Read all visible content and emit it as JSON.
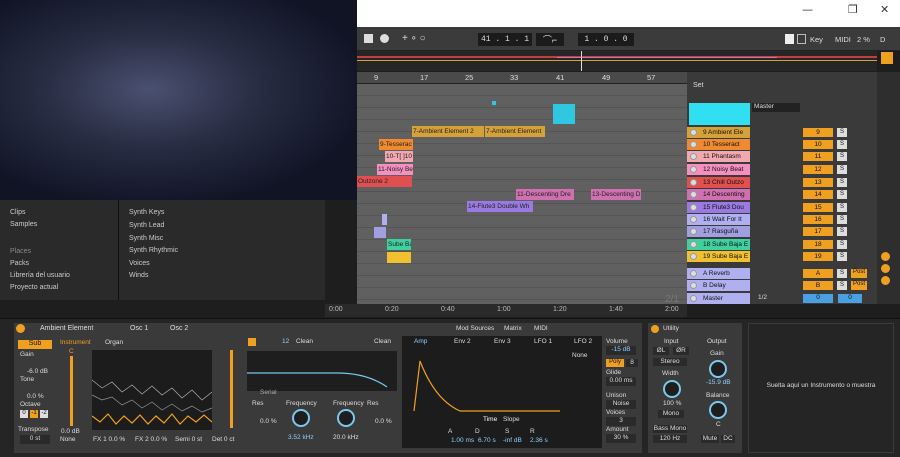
{
  "window": {
    "min": "—",
    "max": "❐",
    "close": "✕"
  },
  "toolbar": {
    "position": "41 .  1 .  1",
    "loop_length": "1 .  0 .  0",
    "key": "Key",
    "midi": "MIDI",
    "cpu": "2 %",
    "d": "D"
  },
  "ruler": {
    "marks": [
      "9",
      "17",
      "25",
      "33",
      "41",
      "49",
      "57"
    ]
  },
  "set_label": "Set",
  "master_select": "Master",
  "clips": [
    {
      "label": "7-Ambient Element 2",
      "color": "#d5a23a"
    },
    {
      "label": "7-Ambient Element",
      "color": "#d5a23a"
    },
    {
      "label": "9-Tesserac",
      "color": "#f08a30"
    },
    {
      "label": "10-T[ ]10",
      "color": "#f2a8b0"
    },
    {
      "label": "11-Noisy Be",
      "color": "#f48fc0"
    },
    {
      "label": "Outzone 2",
      "color": "#e05050"
    },
    {
      "label": "11-Descenting Dre",
      "color": "#d070b0"
    },
    {
      "label": "13-Descenting D",
      "color": "#d070b0"
    },
    {
      "label": "14-Flute3 Double Wh",
      "color": "#9a7ae0"
    },
    {
      "label": "Sube Ba",
      "color": "#40d0a0"
    }
  ],
  "tracks": [
    {
      "name": "9 Ambient Ele",
      "num": "9",
      "color": "#d5a23a"
    },
    {
      "name": "10 Tesseract",
      "num": "10",
      "color": "#f08a30"
    },
    {
      "name": "11 Phantasm",
      "num": "11",
      "color": "#f2a8b0"
    },
    {
      "name": "12 Noisy Beat",
      "num": "12",
      "color": "#f48fc0"
    },
    {
      "name": "13 Chill Outzo",
      "num": "13",
      "color": "#e05050"
    },
    {
      "name": "14 Descenting",
      "num": "14",
      "color": "#d070b0"
    },
    {
      "name": "15 Flute3 Dou",
      "num": "15",
      "color": "#9a7ae0"
    },
    {
      "name": "16 Wait For It",
      "num": "16",
      "color": "#b0b0f0"
    },
    {
      "name": "17 Rasguña",
      "num": "17",
      "color": "#a0a0e0"
    },
    {
      "name": "18 Sube Baja E",
      "num": "18",
      "color": "#40d0a0"
    },
    {
      "name": "19 Sube Baja E",
      "num": "19",
      "color": "#f0c030"
    }
  ],
  "returns": [
    {
      "name": "A Reverb",
      "num": "A",
      "post": "Post"
    },
    {
      "name": "B Delay",
      "num": "B",
      "post": "Post"
    }
  ],
  "master": {
    "name": "Master",
    "ratio": "1/2",
    "val": "0"
  },
  "solo": "S",
  "browser": {
    "left": [
      "Clips",
      "Samples",
      "Places",
      "Packs",
      "Librería del usuario",
      "Proyecto actual"
    ],
    "right": [
      "Synth Keys",
      "Synth Lead",
      "Synth Misc",
      "Synth Rhythmic",
      "Voices",
      "Winds"
    ]
  },
  "timeline": {
    "marks": [
      "0:00",
      "0:20",
      "0:40",
      "1:00",
      "1:20",
      "1:40",
      "2:00"
    ],
    "ratio": "2/1"
  },
  "device": {
    "title": "Ambient Element",
    "osc1": "Osc 1",
    "osc2": "Osc 2",
    "sub": "Sub",
    "gain": "Gain",
    "gain_val": "-6.0 dB",
    "tone": "Tone",
    "tone_val": "0.0 %",
    "octave": "Octave",
    "oct_vals": [
      "0",
      "-1",
      "-2"
    ],
    "transpose": "Transpose",
    "transpose_val": "0 st",
    "instrument": "Instrument",
    "organ": "Organ",
    "c_label": "C",
    "db_val": "0.0 dB",
    "none": "None",
    "fx1": "FX 1  0.0 %",
    "fx2": "FX 2  0.0 %",
    "semi": "Semi  0 st",
    "det": "Det  0 ct",
    "filter_num": "12",
    "clean": "Clean",
    "clean2": "Clean",
    "serial": "Serial",
    "res": "Res",
    "res_val": "0.0 %",
    "frequency": "Frequency",
    "freq_val": "3.52 kHz",
    "frequency2": "Frequency",
    "freq2_val": "20.0 kHz",
    "res2": "Res",
    "res2_val": "0.0 %",
    "tabs": [
      "Mod Sources",
      "Matrix",
      "MIDI"
    ],
    "env_tabs": [
      "Amp",
      "Env 2",
      "Env 3",
      "LFO 1",
      "LFO 2"
    ],
    "env_none": "None",
    "time": "Time",
    "slope": "Slope",
    "adsr": [
      "A",
      "D",
      "S",
      "R"
    ],
    "adsr_vals": [
      "1.00 ms",
      "6.70 s",
      "-inf dB",
      "2.36 s"
    ],
    "volume": "Volume",
    "volume_val": "-15 dB",
    "poly": "Poly",
    "poly_val": "8",
    "glide": "Glide",
    "glide_val": "0.00 ms",
    "unison": "Unison",
    "unison_val": "Noise",
    "voices": "Voices",
    "voices_val": "3",
    "amount": "Amount",
    "amount_val": "30 %"
  },
  "utility": {
    "title": "Utility",
    "input": "Input",
    "output": "Output",
    "lphase": "ØL",
    "rphase": "ØR",
    "stereo": "Stereo",
    "gain": "Gain",
    "gain_val": "-15.9 dB",
    "width": "Width",
    "width_val": "100 %",
    "mono": "Mono",
    "bass_mono": "Bass Mono",
    "bass_freq": "120 Hz",
    "balance": "Balance",
    "balance_val": "C",
    "mute": "Mute",
    "dc": "DC"
  },
  "drop_hint": "Suelta aquí un Instrumento o muestra"
}
